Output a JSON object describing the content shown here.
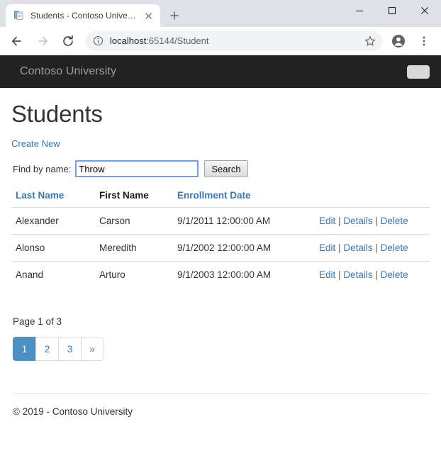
{
  "browser": {
    "tab": {
      "title": "Students - Contoso University",
      "favicon_name": "document-favicon",
      "close_label": "✕"
    },
    "new_tab_label": "+",
    "window_controls": {
      "minimize": "—",
      "maximize": "□",
      "close": "✕"
    },
    "toolbar": {
      "back_label": "←",
      "forward_label": "→",
      "reload_label": "↻",
      "url_host": "localhost",
      "url_rest": ":65144/Student",
      "star_label": "☆",
      "profile_label": "profile",
      "menu_label": "⋮"
    }
  },
  "navbar": {
    "brand": "Contoso University",
    "toggler_name": "navbar-toggler"
  },
  "page": {
    "title": "Students",
    "create_new": "Create New",
    "search": {
      "label": "Find by name:",
      "value": "Throw",
      "placeholder": "",
      "button": "Search"
    },
    "table": {
      "headers": {
        "last_name": "Last Name",
        "first_name": "First Name",
        "enrollment_date": "Enrollment Date",
        "actions": ""
      },
      "rows": [
        {
          "last_name": "Alexander",
          "first_name": "Carson",
          "enrollment_date": "9/1/2011 12:00:00 AM",
          "edit": "Edit",
          "details": "Details",
          "delete": "Delete"
        },
        {
          "last_name": "Alonso",
          "first_name": "Meredith",
          "enrollment_date": "9/1/2002 12:00:00 AM",
          "edit": "Edit",
          "details": "Details",
          "delete": "Delete"
        },
        {
          "last_name": "Anand",
          "first_name": "Arturo",
          "enrollment_date": "9/1/2003 12:00:00 AM",
          "edit": "Edit",
          "details": "Details",
          "delete": "Delete"
        }
      ],
      "separator": "|"
    },
    "page_of": "Page 1 of 3",
    "pagination": {
      "items": [
        {
          "label": "1",
          "active": true
        },
        {
          "label": "2",
          "active": false
        },
        {
          "label": "3",
          "active": false
        },
        {
          "label": "»",
          "active": false
        }
      ]
    },
    "footer": "© 2019 - Contoso University"
  },
  "colors": {
    "navbar_bg": "#222222",
    "link": "#337ab7",
    "pagination_active": "#4a90c4",
    "focus_border": "#6ba3e8"
  }
}
